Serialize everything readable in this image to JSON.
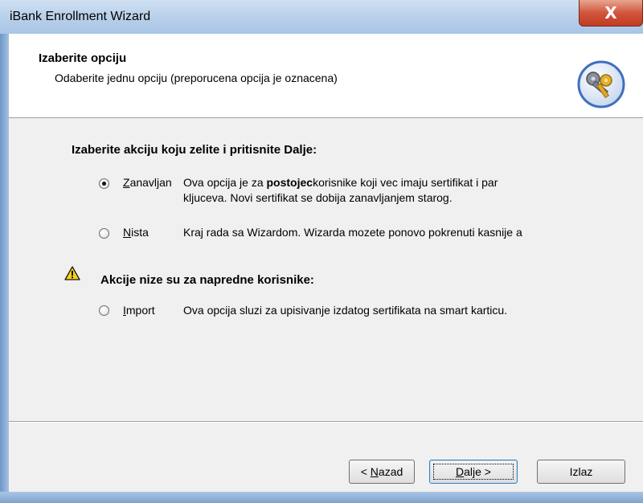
{
  "window": {
    "title": "iBank Enrollment Wizard",
    "close_glyph": "X"
  },
  "header": {
    "title": "Izaberite opciju",
    "subtitle": "Odaberite jednu opciju (preporucena opcija je oznacena)",
    "icon": "keys-icon"
  },
  "main": {
    "prompt": "Izaberite akciju koju zelite i pritisnite Dalje:",
    "options": [
      {
        "label_mnemonic": "Z",
        "label_rest": "anavljan",
        "selected": true,
        "desc_pre": "Ova opcija je za ",
        "desc_bold": "postojec",
        "desc_post": "korisnike koji vec imaju sertifikat i par",
        "desc_line2": "kljuceva. Novi sertifikat se dobija zanavljanjem starog."
      },
      {
        "label_mnemonic": "N",
        "label_rest": "ista",
        "selected": false,
        "desc": "Kraj rada sa Wizardom. Wizarda mozete ponovo pokrenuti kasnije a"
      }
    ],
    "advanced_title": "Akcije nize su za napredne korisnike:",
    "advanced_options": [
      {
        "label_mnemonic": "I",
        "label_rest": "mport",
        "selected": false,
        "desc": "Ova opcija sluzi za upisivanje izdatog sertifikata na smart karticu."
      }
    ]
  },
  "buttons": {
    "back_prefix": "< ",
    "back_mnemonic": "N",
    "back_rest": "azad",
    "next_mnemonic": "D",
    "next_rest": "alje >",
    "exit_label": "Izlaz"
  },
  "colors": {
    "title_bar": "#b7cfe9",
    "close_button": "#c23b22",
    "dialog_bg": "#f0f0f0",
    "default_button_border": "#3c7fb1"
  }
}
